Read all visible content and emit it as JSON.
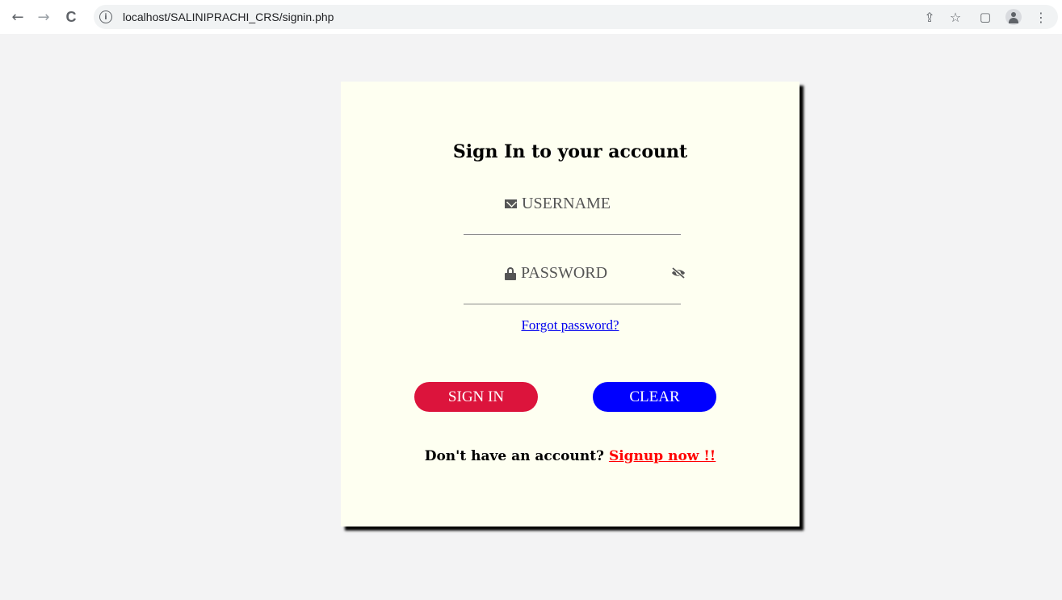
{
  "browser": {
    "back_icon": "←",
    "forward_icon": "→",
    "reload_icon": "C",
    "info_icon": "i",
    "url": "localhost/SALINIPRACHI_CRS/signin.php",
    "share_icon": "⇪",
    "star_icon": "☆",
    "sidepanel_icon": "▢",
    "menu_icon": "⋮"
  },
  "card": {
    "title": "Sign In to your account",
    "username_placeholder": "USERNAME",
    "password_placeholder": "PASSWORD",
    "forgot_link": "Forgot password?",
    "signin_button": "SIGN IN",
    "clear_button": "CLEAR",
    "no_account_text": "Don't have an account?",
    "signup_link": "Signup now !!"
  },
  "colors": {
    "card_bg": "#fefff1",
    "signin_bg": "#dc143c",
    "clear_bg": "#0000ff",
    "link_color": "#0000ee",
    "signup_color": "#ff0000"
  }
}
